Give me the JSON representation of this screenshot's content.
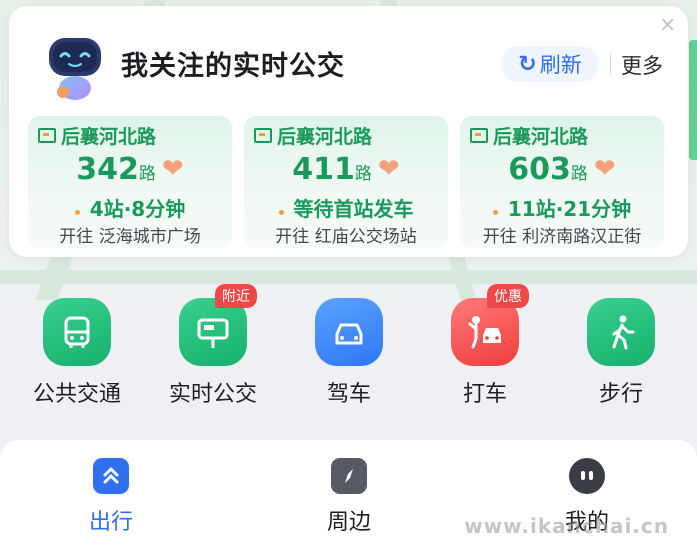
{
  "card": {
    "title": "我关注的实时公交",
    "refresh_label": "刷新",
    "more_label": "更多",
    "close_glyph": "×"
  },
  "stops": [
    {
      "stop_name": "后襄河北路",
      "route": "342",
      "route_suffix": "路",
      "eta": "4站·8分钟",
      "direction": "开往 泛海城市广场"
    },
    {
      "stop_name": "后襄河北路",
      "route": "411",
      "route_suffix": "路",
      "eta": "等待首站发车",
      "direction": "开往 红庙公交场站"
    },
    {
      "stop_name": "后襄河北路",
      "route": "603",
      "route_suffix": "路",
      "eta": "11站·21分钟",
      "direction": "开往 利济南路汉正街"
    }
  ],
  "shortcuts": [
    {
      "label": "公共交通",
      "icon": "bus-icon",
      "badge": ""
    },
    {
      "label": "实时公交",
      "icon": "bus-stop-icon",
      "badge": "附近"
    },
    {
      "label": "驾车",
      "icon": "car-icon",
      "badge": ""
    },
    {
      "label": "打车",
      "icon": "taxi-hail-icon",
      "badge": "优惠"
    },
    {
      "label": "步行",
      "icon": "walk-icon",
      "badge": ""
    }
  ],
  "nav": [
    {
      "label": "出行",
      "icon": "trip-icon",
      "active": true
    },
    {
      "label": "周边",
      "icon": "compass-icon",
      "active": false
    },
    {
      "label": "我的",
      "icon": "profile-icon",
      "active": false
    }
  ],
  "watermark": "www.ikanchai.cn",
  "colors": {
    "accent_blue": "#2f6ff0",
    "route_green": "#1a9a5a",
    "badge_red": "#f04848",
    "heart": "#f2a07a"
  }
}
